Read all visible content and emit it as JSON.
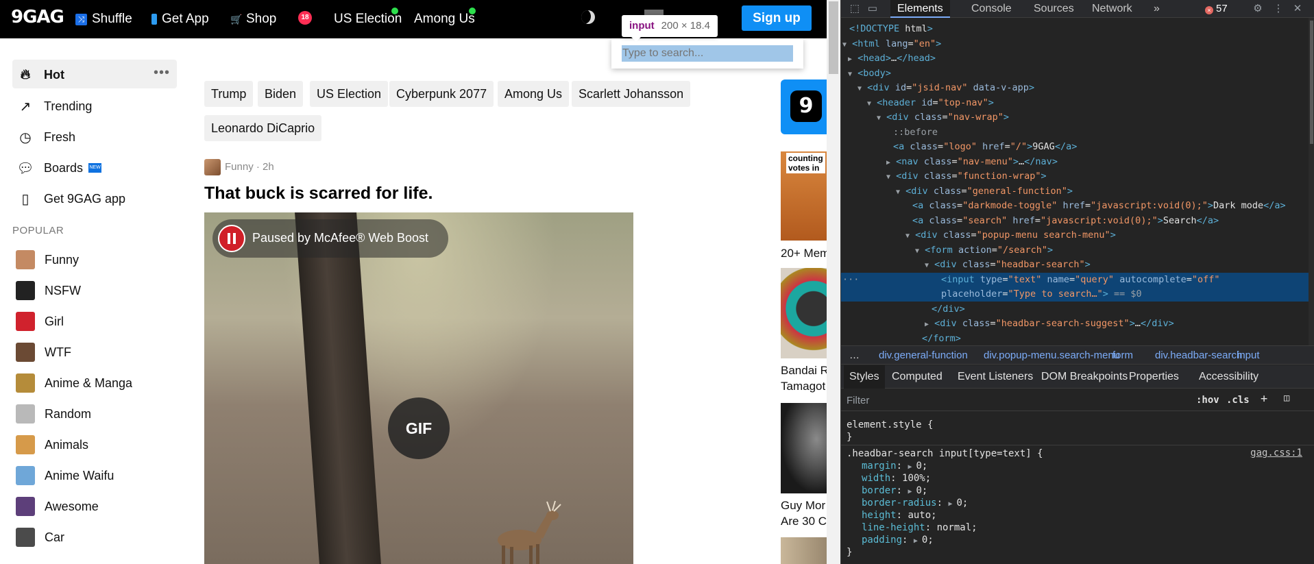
{
  "topnav": {
    "logo": "9GAG",
    "items": [
      {
        "label": "Shuffle",
        "icon": "shuffle-icon"
      },
      {
        "label": "Get App",
        "icon": "phone-icon"
      },
      {
        "label": "Shop",
        "icon": "cart-icon"
      },
      {
        "label": "US Election",
        "dot": true
      },
      {
        "label": "Among Us",
        "dot": true
      }
    ],
    "nsfw_badge": "18",
    "signup": "Sign up"
  },
  "search": {
    "placeholder": "Type to search..."
  },
  "inspector_tooltip": {
    "tag": "input",
    "size": "200 × 18.4"
  },
  "sidebar": {
    "main": [
      {
        "label": "Hot",
        "icon": "fire-icon"
      },
      {
        "label": "Trending",
        "icon": "trending-icon"
      },
      {
        "label": "Fresh",
        "icon": "clock-icon"
      },
      {
        "label": "Boards",
        "icon": "chat-icon",
        "badge": "NEW"
      },
      {
        "label": "Get 9GAG app",
        "icon": "phone-icon"
      }
    ],
    "popular_label": "POPULAR",
    "popular": [
      {
        "label": "Funny",
        "color": "#c48a63"
      },
      {
        "label": "NSFW",
        "color": "#222222"
      },
      {
        "label": "Girl",
        "color": "#d0222d"
      },
      {
        "label": "WTF",
        "color": "#6b4a34"
      },
      {
        "label": "Anime & Manga",
        "color": "#b58c3a"
      },
      {
        "label": "Random",
        "color": "#b9b9b9"
      },
      {
        "label": "Animals",
        "color": "#d69a4a"
      },
      {
        "label": "Anime Waifu",
        "color": "#6fa7d8"
      },
      {
        "label": "Awesome",
        "color": "#5d3f7a"
      },
      {
        "label": "Car",
        "color": "#4b4b4b"
      }
    ]
  },
  "tags": [
    "Trump",
    "Biden",
    "US Election",
    "Cyberpunk 2077",
    "Among Us",
    "Scarlett Johansson",
    "Leonardo DiCaprio"
  ],
  "post": {
    "section": "Funny",
    "age": "2h",
    "meta": "Funny · 2h",
    "title": "That buck is scarred for life.",
    "paused_text": "Paused by McAfee® Web Boost",
    "gif_label": "GIF"
  },
  "right_column": {
    "logo_glyph": "9",
    "thumb1_caption": "counting\nvotes in",
    "item1_text": "20+ Mem",
    "item2_text": [
      "Bandai R",
      "Tamagot"
    ],
    "item3_text": [
      "Guy Mor",
      "Are 30 C"
    ]
  },
  "devtools": {
    "tabs": [
      "Elements",
      "Console",
      "Sources",
      "Network"
    ],
    "more": "»",
    "error_count": "57",
    "dom_lines": [
      "<!DOCTYPE html>",
      "<html lang=\"en\">",
      "<head>…</head>",
      "<body>",
      "<div id=\"jsid-nav\" data-v-app>",
      "<header id=\"top-nav\">",
      "<div class=\"nav-wrap\">",
      "::before",
      "<a class=\"logo\" href=\"/\">9GAG</a>",
      "<nav class=\"nav-menu\">…</nav>",
      "<div class=\"function-wrap\">",
      "<div class=\"general-function\">",
      "<a class=\"darkmode-toggle\" href=\"javascript:void(0);\">Dark mode</a>",
      "<a class=\"search\" href=\"javascript:void(0);\">Search</a>",
      "<div class=\"popup-menu search-menu\">",
      "<form action=\"/search\">",
      "<div class=\"headbar-search\">",
      "<input type=\"text\" name=\"query\" autocomplete=\"off\"",
      "placeholder=\"Type to search…\"> == $0",
      "</div>",
      "<div class=\"headbar-search-suggest\">…</div>",
      "</form>"
    ],
    "breadcrumbs": [
      "…",
      "div.general-function",
      "div.popup-menu.search-menu",
      "form",
      "div.headbar-search",
      "input"
    ],
    "style_tabs": [
      "Styles",
      "Computed",
      "Event Listeners",
      "DOM Breakpoints",
      "Properties",
      "Accessibility"
    ],
    "filter_placeholder": "Filter",
    "hov": ":hov",
    "cls": ".cls",
    "element_style_open": "element.style {",
    "close_brace": "}",
    "rule_selector": ".headbar-search input[type=text] {",
    "rule_source": "gag.css:1",
    "rule_props": [
      {
        "name": "margin",
        "value": "0;",
        "arrow": true
      },
      {
        "name": "width",
        "value": "100%;",
        "arrow": false
      },
      {
        "name": "border",
        "value": "0;",
        "arrow": true
      },
      {
        "name": "border-radius",
        "value": "0;",
        "arrow": true
      },
      {
        "name": "height",
        "value": "auto;",
        "arrow": false
      },
      {
        "name": "line-height",
        "value": "normal;",
        "arrow": false
      },
      {
        "name": "padding",
        "value": "0;",
        "arrow": true
      }
    ]
  }
}
